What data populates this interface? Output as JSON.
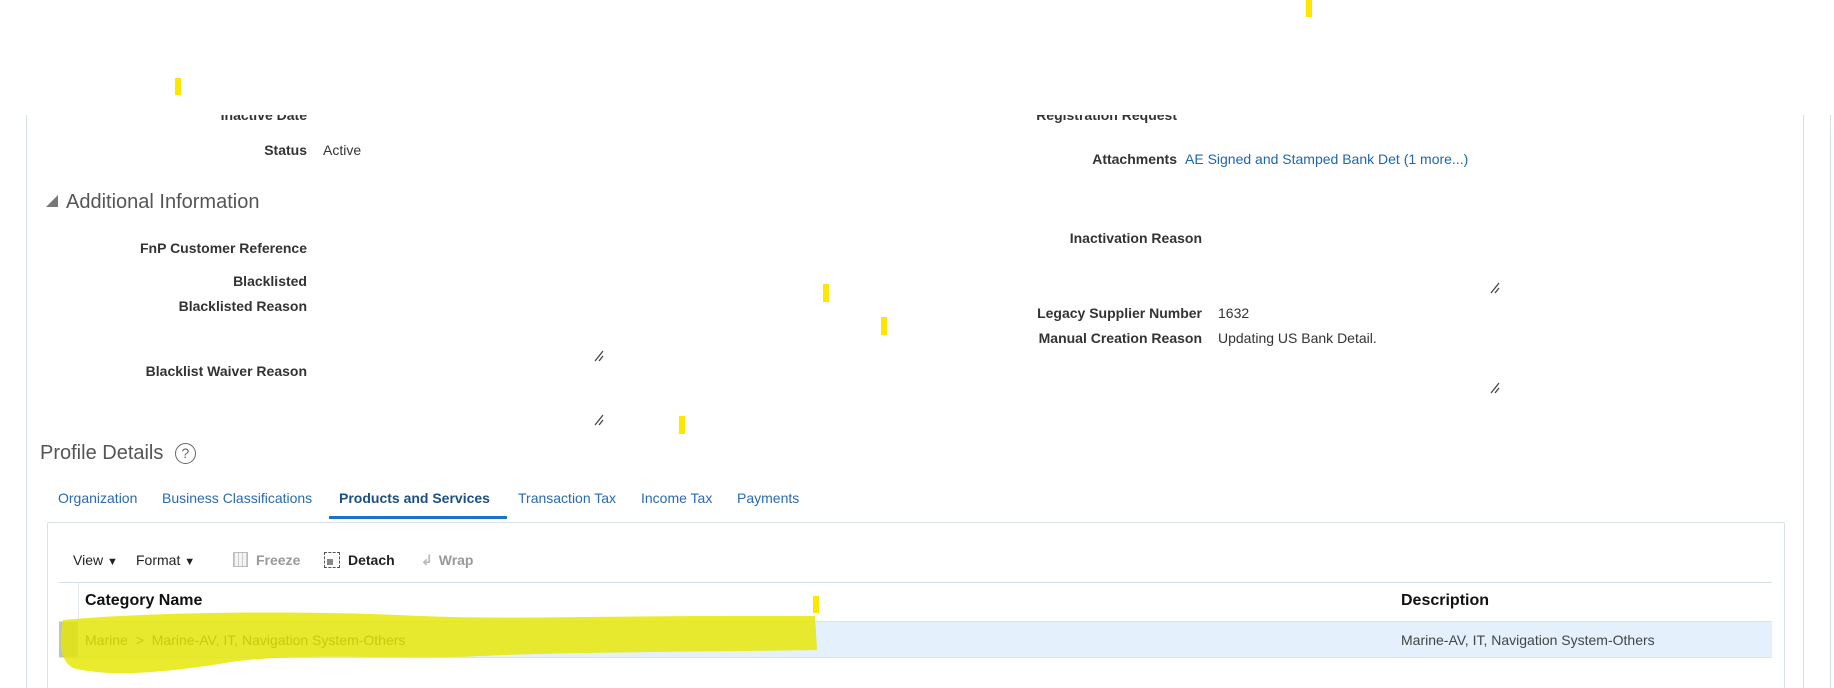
{
  "left_fields": {
    "inactive_date_label": "Inactive Date",
    "status_label": "Status",
    "status_value": "Active"
  },
  "right_fields": {
    "registration_request_label": "Registration Request",
    "attachments_label": "Attachments",
    "attachments_value": "AE Signed and Stamped Bank Det (1 more...)"
  },
  "additional_information": {
    "title": "Additional Information",
    "fnp_customer_reference_label": "FnP Customer Reference",
    "blacklisted_label": "Blacklisted",
    "blacklisted_reason_label": "Blacklisted Reason",
    "blacklist_waiver_reason_label": "Blacklist Waiver Reason",
    "inactivation_reason_label": "Inactivation Reason",
    "legacy_supplier_number_label": "Legacy Supplier Number",
    "legacy_supplier_number_value": "1632",
    "manual_creation_reason_label": "Manual Creation Reason",
    "manual_creation_reason_value": "Updating US Bank Detail."
  },
  "profile_details": {
    "title": "Profile Details",
    "tabs": [
      "Organization",
      "Business Classifications",
      "Products and Services",
      "Transaction Tax",
      "Income Tax",
      "Payments"
    ],
    "active_tab": "Products and Services"
  },
  "toolbar": {
    "view": "View",
    "format": "Format",
    "freeze": "Freeze",
    "detach": "Detach",
    "wrap": "Wrap"
  },
  "table": {
    "columns": [
      "Category Name",
      "Description"
    ],
    "rows": [
      {
        "category": "Marine",
        "separator": ">",
        "subcategory": "Marine-AV, IT, Navigation System-Others",
        "description": "Marine-AV, IT, Navigation System-Others"
      }
    ]
  },
  "colors": {
    "link": "#1f66ad",
    "highlight": "#e6e600",
    "selected_row": "#e4f0fb"
  }
}
